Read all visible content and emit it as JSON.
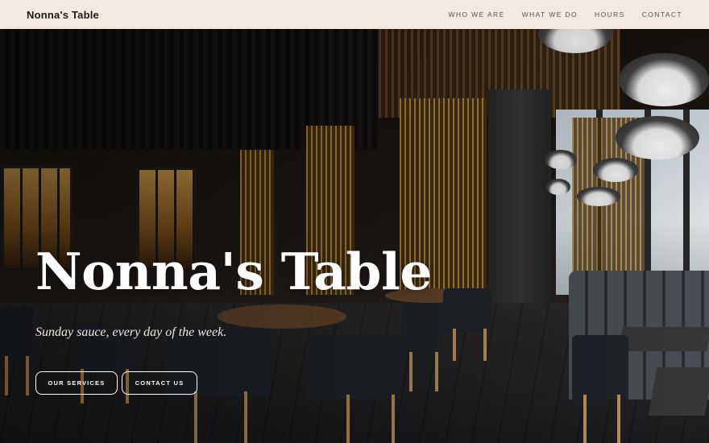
{
  "nav": {
    "brand": "Nonna's Table",
    "links": [
      "WHO WE ARE",
      "WHAT WE DO",
      "HOURS",
      "CONTACT"
    ]
  },
  "hero": {
    "headline": "Nonna's Table",
    "tagline": "Sunday sauce, every day of the week.",
    "buttons": {
      "services": "OUR SERVICES",
      "contact": "CONTACT US"
    }
  },
  "colors": {
    "nav_background": "#f3e9df",
    "brand_text": "#1b1b1b",
    "hero_text": "#ffffff"
  }
}
